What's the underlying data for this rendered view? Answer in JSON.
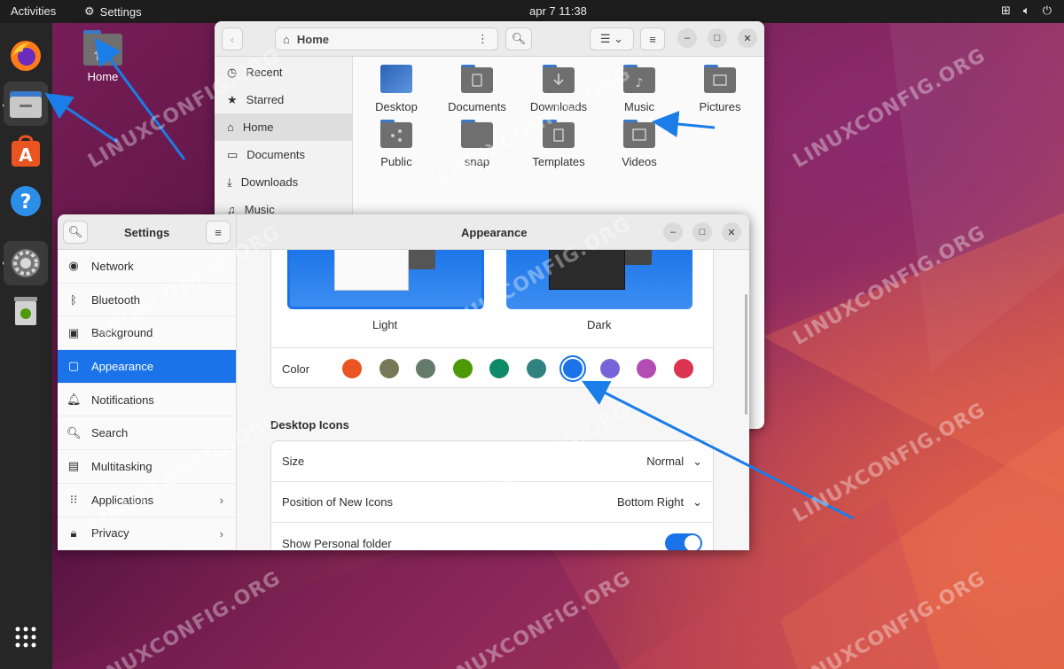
{
  "topbar": {
    "activities": "Activities",
    "app_name": "Settings",
    "clock": "apr 7  11:38"
  },
  "desktop": {
    "home_label": "Home"
  },
  "files": {
    "location": "Home",
    "sidebar": [
      {
        "label": "Recent",
        "icon": "clock-icon"
      },
      {
        "label": "Starred",
        "icon": "star-icon"
      },
      {
        "label": "Home",
        "icon": "home-icon",
        "selected": true
      },
      {
        "label": "Documents",
        "icon": "document-icon"
      },
      {
        "label": "Downloads",
        "icon": "download-icon"
      },
      {
        "label": "Music",
        "icon": "music-icon"
      }
    ],
    "folders": [
      {
        "label": "Desktop",
        "color": "#3a78c9"
      },
      {
        "label": "Documents",
        "color": "#6f6f6f"
      },
      {
        "label": "Downloads",
        "color": "#6f6f6f"
      },
      {
        "label": "Music",
        "color": "#6f6f6f"
      },
      {
        "label": "Pictures",
        "color": "#6f6f6f"
      },
      {
        "label": "Public",
        "color": "#6f6f6f"
      },
      {
        "label": "snap",
        "color": "#6f6f6f"
      },
      {
        "label": "Templates",
        "color": "#6f6f6f"
      },
      {
        "label": "Videos",
        "color": "#6f6f6f"
      }
    ]
  },
  "settings": {
    "title": "Settings",
    "panel_title": "Appearance",
    "nav": [
      {
        "label": "Network",
        "icon": "network-icon"
      },
      {
        "label": "Bluetooth",
        "icon": "bluetooth-icon"
      },
      {
        "label": "Background",
        "icon": "background-icon"
      },
      {
        "label": "Appearance",
        "icon": "appearance-icon",
        "selected": true
      },
      {
        "label": "Notifications",
        "icon": "bell-icon"
      },
      {
        "label": "Search",
        "icon": "search-icon"
      },
      {
        "label": "Multitasking",
        "icon": "multitasking-icon"
      },
      {
        "label": "Applications",
        "icon": "grid-icon",
        "chevron": true
      },
      {
        "label": "Privacy",
        "icon": "lock-icon",
        "chevron": true
      }
    ],
    "style": {
      "light_label": "Light",
      "dark_label": "Dark"
    },
    "color_label": "Color",
    "accent_colors": [
      "#e95420",
      "#787859",
      "#657b69",
      "#4e9a06",
      "#0e8a66",
      "#308280",
      "#1a73e8",
      "#7764d8",
      "#b34cb3",
      "#da3450"
    ],
    "selected_accent": "#1a73e8",
    "desktop_icons": {
      "heading": "Desktop Icons",
      "size_label": "Size",
      "size_value": "Normal",
      "position_label": "Position of New Icons",
      "position_value": "Bottom Right",
      "personal_label": "Show Personal folder",
      "personal_enabled": true
    }
  },
  "watermark": "LINUXCONFIG.ORG"
}
